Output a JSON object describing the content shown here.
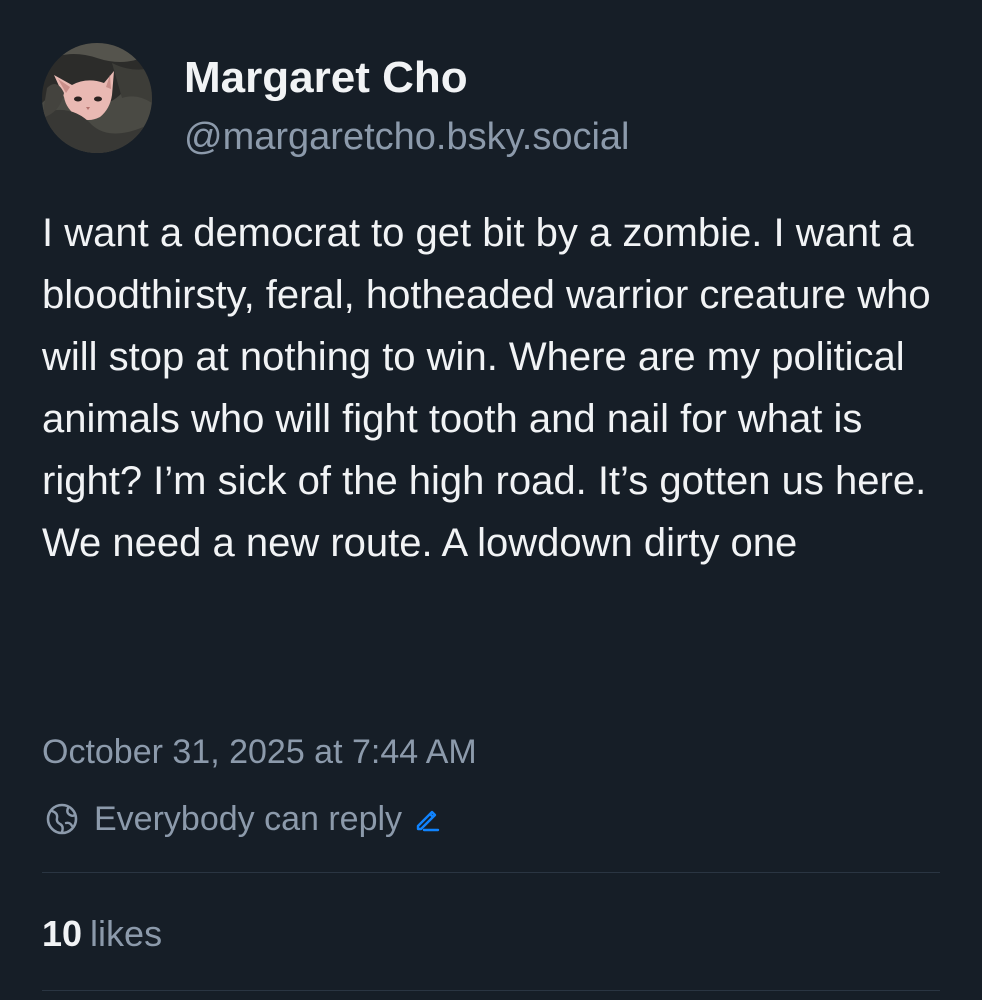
{
  "author": {
    "display_name": "Margaret Cho",
    "handle": "@margaretcho.bsky.social",
    "avatar_icon": "cat-in-blanket-avatar"
  },
  "post": {
    "text": "I want a democrat to get bit by a zombie. I want a bloodthirsty, feral, hotheaded warrior creature who will stop at nothing to win. Where are my political animals who will fight tooth and nail for what is right? I’m sick of the high road. It’s gotten us here. We need a new route. A lowdown dirty one",
    "timestamp": "October 31, 2025 at 7:44 AM"
  },
  "reply_settings": {
    "icon": "globe-icon",
    "label": "Everybody can reply",
    "edit_icon": "pencil-icon"
  },
  "stats": {
    "likes_count": "10",
    "likes_label": "likes"
  },
  "colors": {
    "background": "#161e27",
    "text_primary": "#f1f3f5",
    "text_secondary": "#8c9aab",
    "accent": "#1083fe",
    "divider": "#2a3542"
  }
}
